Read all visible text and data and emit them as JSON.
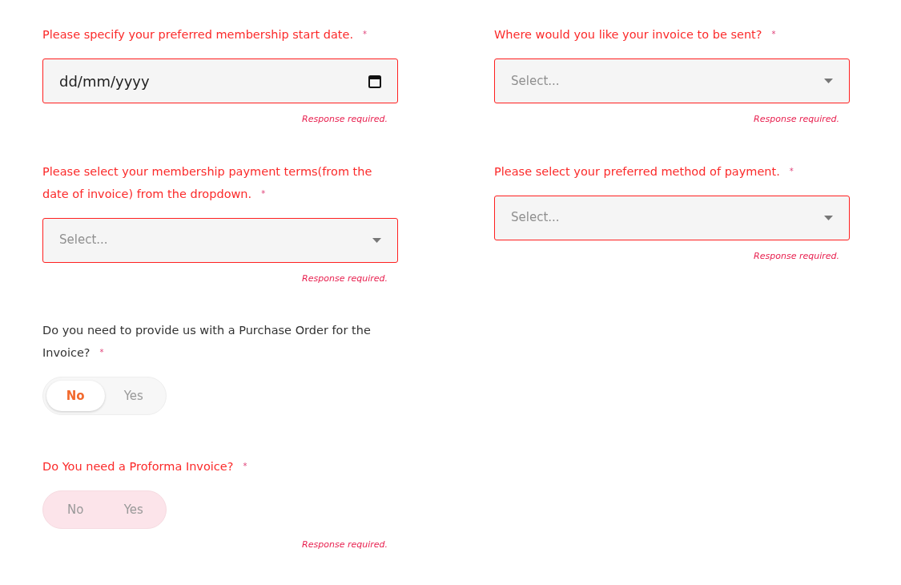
{
  "columns": [
    {
      "fields": [
        {
          "kind": "date",
          "label": "Please specify your preferred membership start date.",
          "required": "*",
          "invalid": true,
          "value": "dd/mm/yyyy",
          "error": "Response required."
        },
        {
          "kind": "select",
          "label": "Please select your membership payment terms(from the date of invoice) from the dropdown.",
          "required": "*",
          "invalid": true,
          "placeholder": "Select...",
          "error": "Response required."
        },
        {
          "kind": "toggle",
          "label": "Do you need to provide us with a Purchase Order for the Invoice?",
          "required": "*",
          "invalid": false,
          "options": [
            {
              "label": "No",
              "selected": true
            },
            {
              "label": "Yes",
              "selected": false
            }
          ]
        },
        {
          "kind": "toggle",
          "label": "Do You need a Proforma Invoice?",
          "required": "*",
          "invalid": true,
          "options": [
            {
              "label": "No",
              "selected": false
            },
            {
              "label": "Yes",
              "selected": false
            }
          ],
          "error": "Response required."
        }
      ]
    },
    {
      "fields": [
        {
          "kind": "select",
          "label": "Where would you like your invoice to be sent?",
          "required": "*",
          "invalid": true,
          "placeholder": "Select...",
          "error": "Response required."
        },
        {
          "kind": "select",
          "label": "Please select your preferred method of payment.",
          "required": "*",
          "invalid": true,
          "placeholder": "Select...",
          "error": "Response required."
        }
      ]
    }
  ]
}
